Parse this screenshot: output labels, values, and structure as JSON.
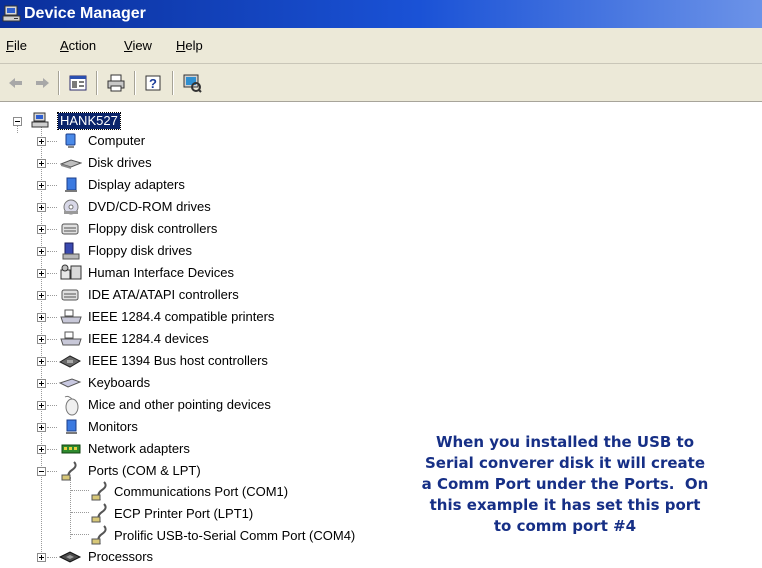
{
  "window": {
    "title": "Device Manager",
    "icon": "computer-icon"
  },
  "menu": [
    {
      "label": "File",
      "key": "F",
      "rest": "ile"
    },
    {
      "label": "Action",
      "key": "A",
      "rest": "ction"
    },
    {
      "label": "View",
      "key": "V",
      "rest": "iew"
    },
    {
      "label": "Help",
      "key": "H",
      "rest": "elp"
    }
  ],
  "toolbar": [
    "back-arrow-icon",
    "forward-arrow-icon",
    "properties-icon",
    "print-icon",
    "help-icon",
    "scan-hardware-icon"
  ],
  "tree": {
    "root": {
      "label": "HANK527",
      "icon": "computer-icon",
      "selected": true
    },
    "categories": [
      {
        "label": "Computer",
        "icon": "computer-icon"
      },
      {
        "label": "Disk drives",
        "icon": "disk-drive-icon"
      },
      {
        "label": "Display adapters",
        "icon": "display-adapter-icon"
      },
      {
        "label": "DVD/CD-ROM drives",
        "icon": "dvd-drive-icon"
      },
      {
        "label": "Floppy disk controllers",
        "icon": "controller-icon"
      },
      {
        "label": "Floppy disk drives",
        "icon": "floppy-drive-icon"
      },
      {
        "label": "Human Interface Devices",
        "icon": "hid-icon"
      },
      {
        "label": "IDE ATA/ATAPI controllers",
        "icon": "controller-icon"
      },
      {
        "label": "IEEE 1284.4 compatible printers",
        "icon": "printer-icon"
      },
      {
        "label": "IEEE 1284.4 devices",
        "icon": "printer-icon"
      },
      {
        "label": "IEEE 1394 Bus host controllers",
        "icon": "bus-controller-icon"
      },
      {
        "label": "Keyboards",
        "icon": "keyboard-icon"
      },
      {
        "label": "Mice and other pointing devices",
        "icon": "mouse-icon"
      },
      {
        "label": "Monitors",
        "icon": "monitor-icon"
      },
      {
        "label": "Network adapters",
        "icon": "network-adapter-icon"
      },
      {
        "label": "Ports (COM & LPT)",
        "icon": "port-icon",
        "expanded": true
      },
      {
        "label": "Processors",
        "icon": "processor-icon"
      }
    ],
    "ports_children": [
      {
        "label": "Communications Port (COM1)",
        "icon": "port-icon"
      },
      {
        "label": "ECP Printer Port (LPT1)",
        "icon": "port-icon"
      },
      {
        "label": "Prolific USB-to-Serial Comm Port (COM4)",
        "icon": "port-icon"
      }
    ]
  },
  "annotation": {
    "lines": [
      "When you installed the USB to",
      "Serial converer disk it will create",
      "a Comm Port under the Ports.  On",
      "this example it has set this port",
      "to comm port #4"
    ],
    "color": "#162f86"
  }
}
